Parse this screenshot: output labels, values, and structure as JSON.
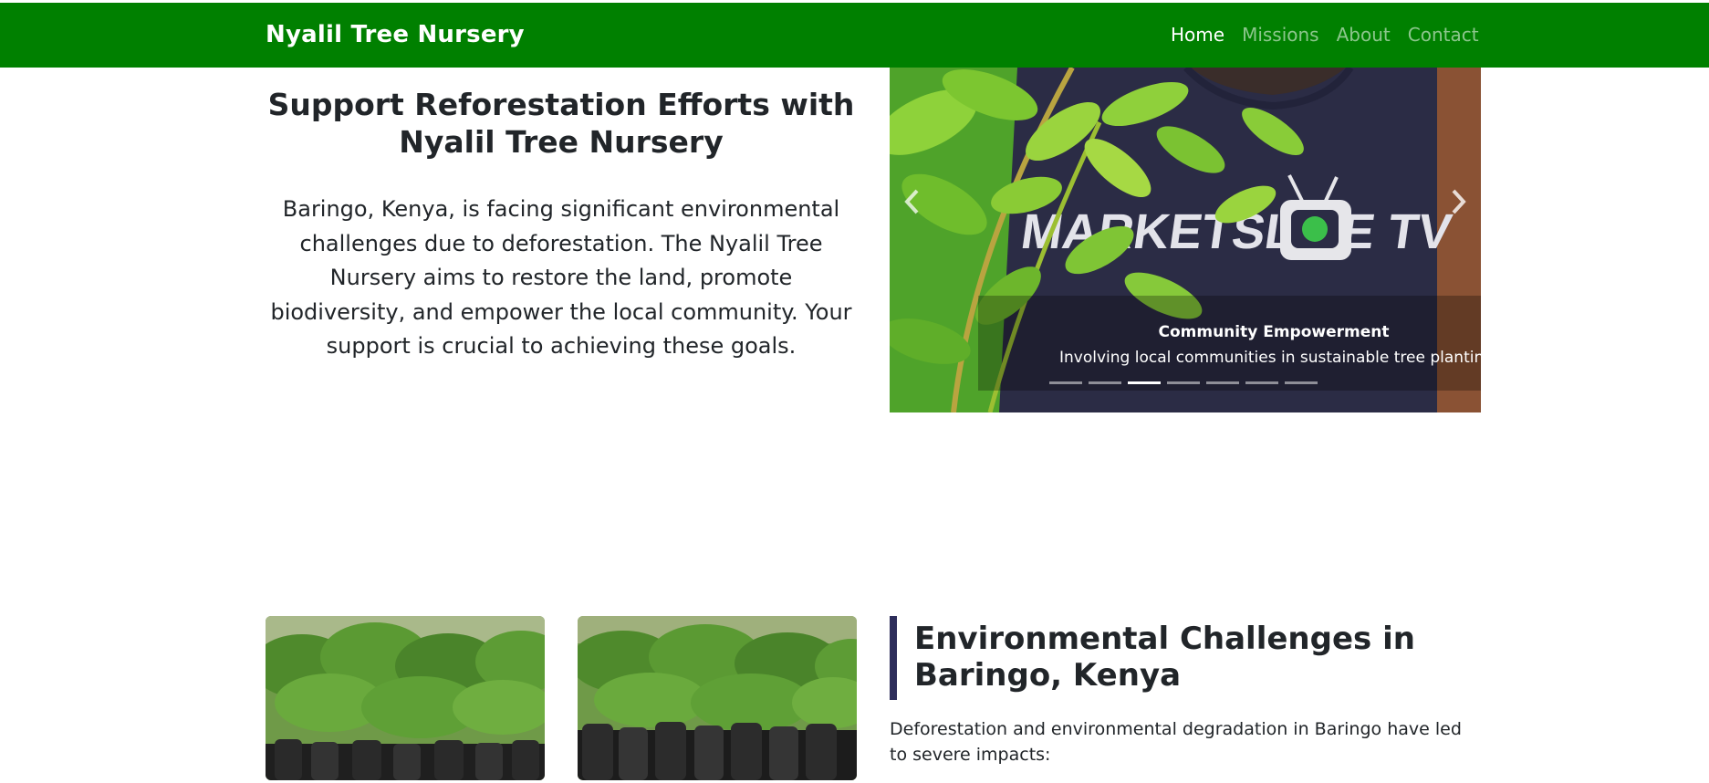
{
  "navbar": {
    "brand": "Nyalil Tree Nursery",
    "links": [
      "Home",
      "Missions",
      "About",
      "Contact"
    ],
    "active": "Home",
    "background": "#008000"
  },
  "hero": {
    "title": "Support Reforestation Efforts with Nyalil Tree Nursery",
    "text": "Baringo, Kenya, is facing significant environmental challenges due to deforestation. The Nyalil Tree Nursery aims to restore the land, promote biodiversity, and empower the local community. Your support is crucial to achieving these goals."
  },
  "carousel": {
    "caption_title": "Community Empowerment",
    "caption_text": "Involving local communities in sustainable tree planting",
    "slide_count": 7,
    "active_slide": 3,
    "prev_icon": "chevron-left-icon",
    "next_icon": "chevron-right-icon",
    "shirt_text": "MARKETSLIVE TV"
  },
  "section": {
    "title": "Environmental Challenges in Baringo, Kenya",
    "text": "Deforestation and environmental degradation in Baringo have led to severe impacts:",
    "accent": "#2d2d5a"
  }
}
